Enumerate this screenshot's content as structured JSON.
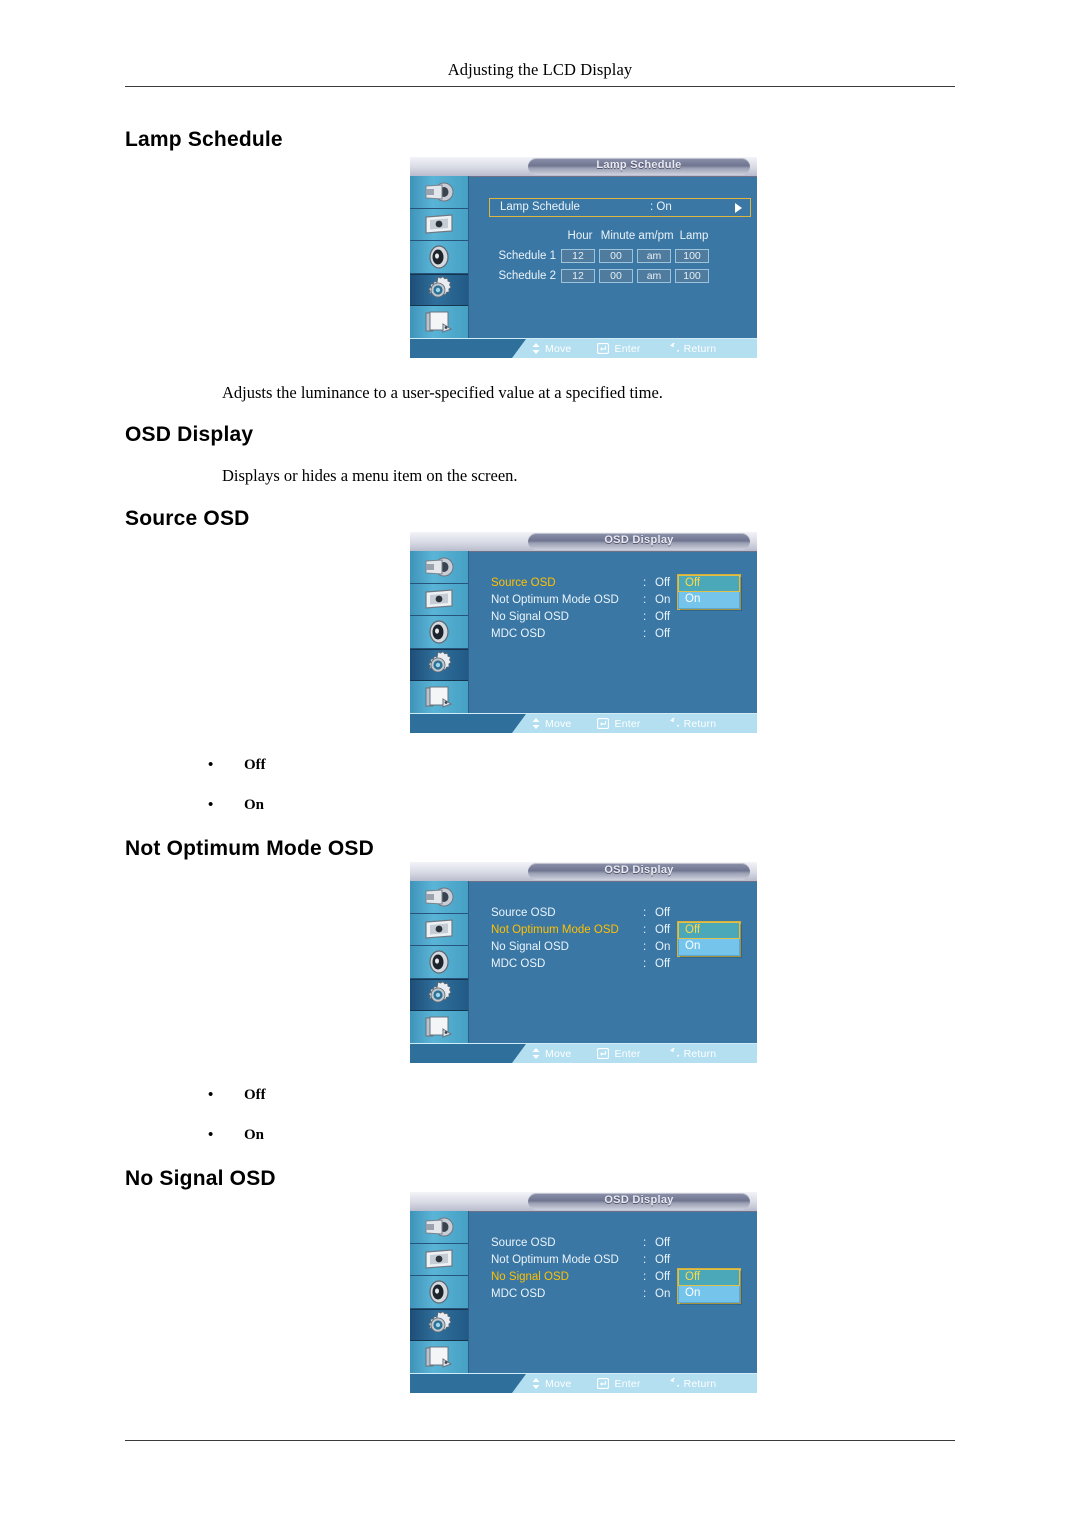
{
  "document": {
    "running_head": "Adjusting the LCD Display"
  },
  "sections": {
    "lamp_schedule": {
      "heading": "Lamp Schedule",
      "description": "Adjusts the luminance to a user-specified value at a specified time."
    },
    "osd_display": {
      "heading": "OSD Display",
      "description": "Displays or hides a menu item on the screen."
    },
    "source_osd": {
      "heading": "Source OSD",
      "options": [
        "Off",
        "On"
      ]
    },
    "not_optimum_mode_osd": {
      "heading": "Not Optimum Mode OSD",
      "options": [
        "Off",
        "On"
      ]
    },
    "no_signal_osd": {
      "heading": "No Signal OSD"
    }
  },
  "osd_nav": {
    "move": "Move",
    "enter": "Enter",
    "return": "Return"
  },
  "osd_sidebar_icons": [
    "input-source-icon",
    "picture-display-icon",
    "sound-speaker-icon",
    "setup-gear-icon",
    "multi-control-pages-icon"
  ],
  "osd_lamp_schedule": {
    "title": "Lamp Schedule",
    "main_row": {
      "label": "Lamp Schedule",
      "colon": ":",
      "value": "On"
    },
    "table": {
      "columns": [
        "Hour",
        "Minute",
        "am/pm",
        "Lamp"
      ],
      "rows": [
        {
          "name": "Schedule 1",
          "cells": [
            "12",
            "00",
            "am",
            "100"
          ]
        },
        {
          "name": "Schedule 2",
          "cells": [
            "12",
            "00",
            "am",
            "100"
          ]
        }
      ]
    }
  },
  "osd_source": {
    "title": "OSD Display",
    "rows": [
      {
        "label": "Source OSD",
        "colon": ":",
        "value": "Off",
        "highlight": true
      },
      {
        "label": "Not Optimum Mode OSD",
        "colon": ":",
        "value": "On",
        "highlight": false
      },
      {
        "label": "No Signal OSD",
        "colon": ":",
        "value": "Off",
        "highlight": false
      },
      {
        "label": "MDC OSD",
        "colon": ":",
        "value": "Off",
        "highlight": false
      }
    ],
    "dropdown": {
      "selected": "Off",
      "other": "On"
    }
  },
  "osd_notoptimum": {
    "title": "OSD Display",
    "rows": [
      {
        "label": "Source OSD",
        "colon": ":",
        "value": "Off",
        "highlight": false
      },
      {
        "label": "Not Optimum Mode OSD",
        "colon": ":",
        "value": "Off",
        "highlight": true
      },
      {
        "label": "No Signal OSD",
        "colon": ":",
        "value": "On",
        "highlight": false
      },
      {
        "label": "MDC OSD",
        "colon": ":",
        "value": "Off",
        "highlight": false
      }
    ],
    "dropdown": {
      "selected": "Off",
      "other": "On"
    }
  },
  "osd_nosignal": {
    "title": "OSD Display",
    "rows": [
      {
        "label": "Source OSD",
        "colon": ":",
        "value": "Off",
        "highlight": false
      },
      {
        "label": "Not Optimum Mode OSD",
        "colon": ":",
        "value": "Off",
        "highlight": false
      },
      {
        "label": "No Signal OSD",
        "colon": ":",
        "value": "Off",
        "highlight": true
      },
      {
        "label": "MDC OSD",
        "colon": ":",
        "value": "On",
        "highlight": false
      }
    ],
    "dropdown": {
      "selected": "Off",
      "other": "On"
    }
  },
  "colors": {
    "osd_background": "#3b77a4",
    "osd_sidebar": "#4aa6cb",
    "highlight_text": "#ffc000",
    "selected_option_bg": "#4aa8b8",
    "selected_option_text": "#ffd84a",
    "unselected_option_bg": "#74c4ec",
    "navbar_bg": "#b3dff0",
    "border_gold": "#e0b53c"
  }
}
